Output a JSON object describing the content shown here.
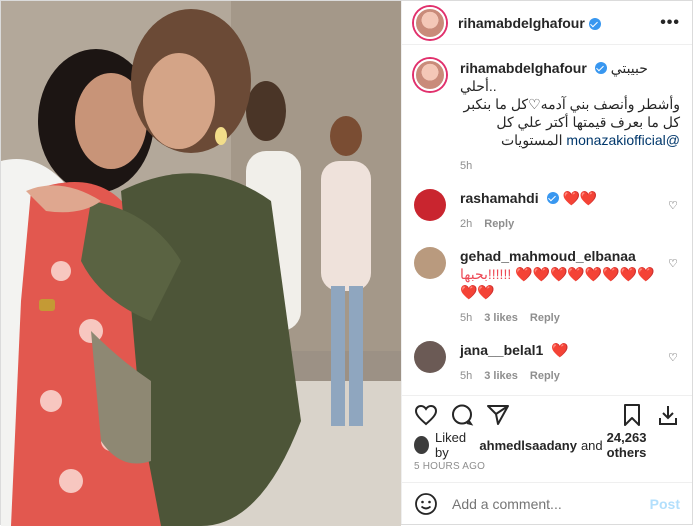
{
  "photo": {
    "description": ""
  },
  "header": {
    "username": "rihamabdelghafour",
    "more_label": "•••"
  },
  "caption": {
    "username": "rihamabdelghafour",
    "text_line1": "حبيبتي ..أحلي",
    "text_line2": "وأشطر وأنصف بني آدمه♡كل ما بنكبر",
    "text_line3": "كل ما بعرف قيمتها أكتر علي كل",
    "text_line4": "المستويات",
    "mention": "@monazakiofficial",
    "time": "5h"
  },
  "comments": [
    {
      "username": "rashamahdi",
      "text": "❤️❤️",
      "time": "2h",
      "likes": "",
      "reply": "Reply",
      "avatar_color": "#c9252f",
      "verified": true
    },
    {
      "username": "gehad_mahmoud_elbanaa",
      "text": "بحبها!!!!!! ❤️❤️❤️❤️❤️❤️❤️❤️❤️❤️",
      "time": "5h",
      "likes": "3 likes",
      "reply": "Reply",
      "avatar_color": "#b99a7e",
      "verified": false
    },
    {
      "username": "jana__belal1",
      "text": "❤️",
      "time": "5h",
      "likes": "3 likes",
      "reply": "Reply",
      "avatar_color": "#6b5a55",
      "verified": false
    }
  ],
  "likes": {
    "prefix": "Liked by",
    "user": "ahmedlsaadany",
    "middle": "and",
    "count": "24,263 others"
  },
  "timestamp": "5 HOURS AGO",
  "add_comment": {
    "placeholder": "Add a comment...",
    "post_label": "Post"
  }
}
